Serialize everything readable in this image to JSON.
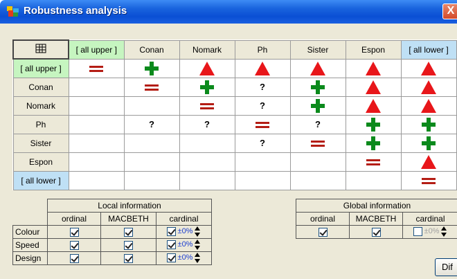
{
  "window": {
    "title": "Robustness analysis",
    "close_label": "X"
  },
  "matrix": {
    "corner_icon": "table-grid-icon",
    "columns": [
      "[ all upper ]",
      "Conan",
      "Nomark",
      "Ph",
      "Sister",
      "Espon",
      "[ all lower ]"
    ],
    "rows": [
      {
        "label": "[ all upper ]",
        "cells": [
          "eq",
          "plus",
          "tri",
          "tri",
          "tri",
          "tri",
          "tri"
        ]
      },
      {
        "label": "Conan",
        "cells": [
          "",
          "eq",
          "plus",
          "?",
          "plus",
          "tri",
          "tri"
        ]
      },
      {
        "label": "Nomark",
        "cells": [
          "",
          "",
          "eq",
          "?",
          "plus",
          "tri",
          "tri"
        ]
      },
      {
        "label": "Ph",
        "cells": [
          "",
          "?",
          "?",
          "eq",
          "?",
          "plus",
          "plus"
        ]
      },
      {
        "label": "Sister",
        "cells": [
          "",
          "",
          "",
          "?",
          "eq",
          "plus",
          "plus"
        ]
      },
      {
        "label": "Espon",
        "cells": [
          "",
          "",
          "",
          "",
          "",
          "eq",
          "tri"
        ]
      },
      {
        "label": "[ all lower ]",
        "cells": [
          "",
          "",
          "",
          "",
          "",
          "",
          "eq"
        ]
      }
    ],
    "colors": {
      "triangle": "#e8161a",
      "plus": "#0b8a1c",
      "equal": "#b41d14",
      "upper_bg": "#c6f5c0",
      "lower_bg": "#bfe0f5"
    }
  },
  "local_info": {
    "title": "Local information",
    "col_ordinal": "ordinal",
    "col_macbeth": "MACBETH",
    "col_cardinal": "cardinal",
    "rows": [
      {
        "label": "Colour",
        "pct": "±0%"
      },
      {
        "label": "Speed",
        "pct": "±0%"
      },
      {
        "label": "Design",
        "pct": "±0%"
      }
    ]
  },
  "global_info": {
    "title": "Global information",
    "col_ordinal": "ordinal",
    "col_macbeth": "MACBETH",
    "col_cardinal": "cardinal",
    "pct": "±0%"
  },
  "dif_button_label": "Dif"
}
